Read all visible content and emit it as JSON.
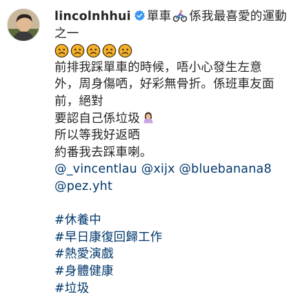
{
  "post": {
    "username": "lincolnhhui",
    "caption_intro": "單車",
    "caption_intro_rest": "係我最喜愛的運動",
    "caption_line2": "之一",
    "emoji_count": 5,
    "body_lines": [
      "前排我踩單車的時候，唔小心發生左意",
      "外，周身傷哂，好彩無骨折。係班車友面",
      "前，絕對",
      "要認自己係垃圾"
    ],
    "body_lines_after": [
      "所以等我好返晒",
      "約番我去踩車喇。"
    ],
    "mentions_line1": [
      "@_vincentlau",
      "@xijx",
      "@bluebanana8"
    ],
    "mentions_line2": [
      "@pez.yht"
    ],
    "hashtags": [
      "#休養中",
      "#早日康復回歸工作",
      "#熱愛演戲",
      "#身體健康",
      "#垃圾"
    ],
    "icons": {
      "verified": "verified-badge-icon",
      "bike": "cyclist-icon",
      "sad": "sad-face-icon",
      "facepalm": "woman-facepalming-icon"
    },
    "colors": {
      "text": "#262626",
      "link": "#00376b",
      "verified": "#3897f0",
      "emoji": "#f5b028"
    }
  }
}
